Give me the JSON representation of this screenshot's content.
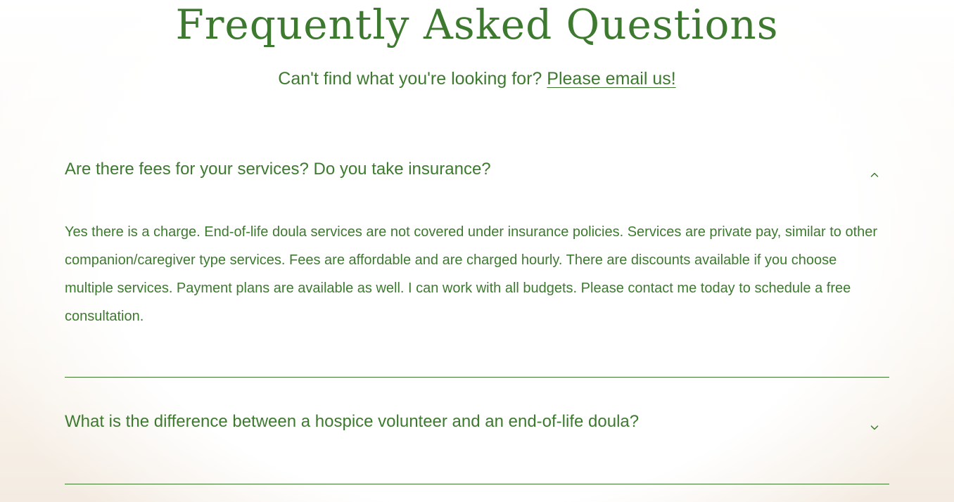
{
  "header": {
    "title": "Frequently Asked Questions",
    "subtitle_text": "Can't find what you're looking for?",
    "email_link_label": "Please email us!"
  },
  "faq": {
    "items": [
      {
        "question": "Are there fees for your services? Do you take insurance?",
        "expanded": true,
        "answer": "Yes there is a charge. End-of-life doula services are not covered under insurance policies. Services are private pay, similar to other companion/caregiver type services. Fees are affordable and are charged hourly. There are discounts available if you choose multiple services. Payment plans are available as well. I can work with all budgets. Please contact me today to schedule a free consultation.",
        "icon": "chevron-up-icon"
      },
      {
        "question": "What is the difference between a hospice volunteer and an end-of-life doula?",
        "expanded": false,
        "icon": "chevron-down-icon"
      }
    ]
  },
  "colors": {
    "brand_green": "#3d7a2f",
    "background": "#ffffff",
    "background_warm": "#f4ece2"
  }
}
